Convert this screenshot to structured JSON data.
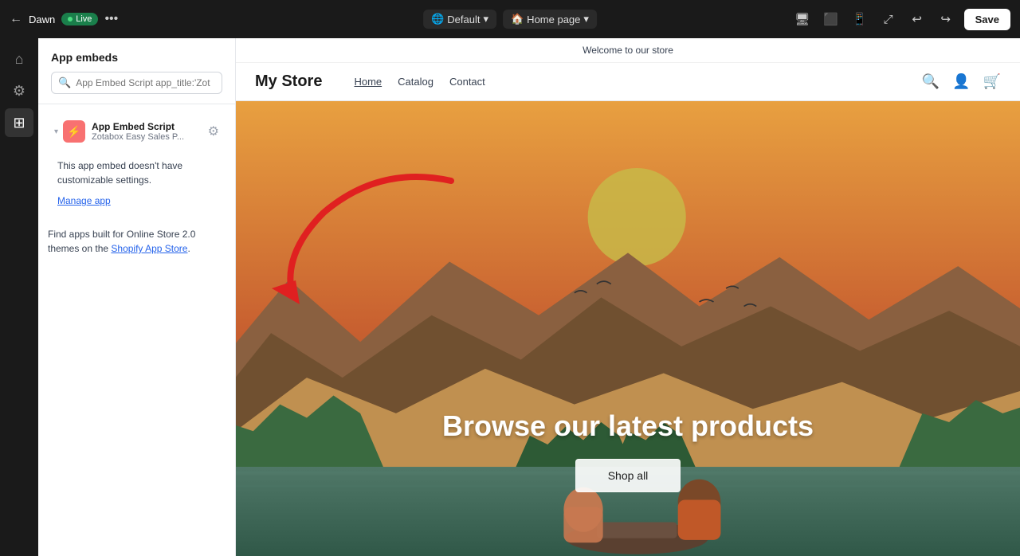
{
  "topbar": {
    "theme_name": "Dawn",
    "live_label": "Live",
    "more_btn": "•••",
    "view_label": "Default",
    "page_label": "Home page",
    "save_label": "Save"
  },
  "sidebar": {
    "title": "App embeds",
    "search_placeholder": "App Embed Script app_title:'Zot",
    "app_item": {
      "name": "App Embed Script",
      "sub": "Zotabox Easy Sales P...",
      "description": "This app embed doesn't have customizable settings.",
      "manage_label": "Manage app"
    },
    "shopify_note_prefix": "Find apps built for Online Store 2.0 themes on the ",
    "shopify_link_label": "Shopify App Store",
    "shopify_note_suffix": "."
  },
  "store": {
    "announcement": "Welcome to our store",
    "logo": "My Store",
    "nav_links": [
      "Home",
      "Catalog",
      "Contact"
    ],
    "hero_title": "Browse our latest products",
    "hero_btn": "Shop all"
  },
  "icons": {
    "back": "←",
    "search": "⌕",
    "desktop": "🖥",
    "tablet": "⬜",
    "mobile": "📱",
    "expand": "⤢",
    "undo": "↩",
    "redo": "↪",
    "home": "⌂",
    "settings": "⚙",
    "blocks": "⊞",
    "search_store": "🔍",
    "account": "👤",
    "cart": "🛒"
  }
}
